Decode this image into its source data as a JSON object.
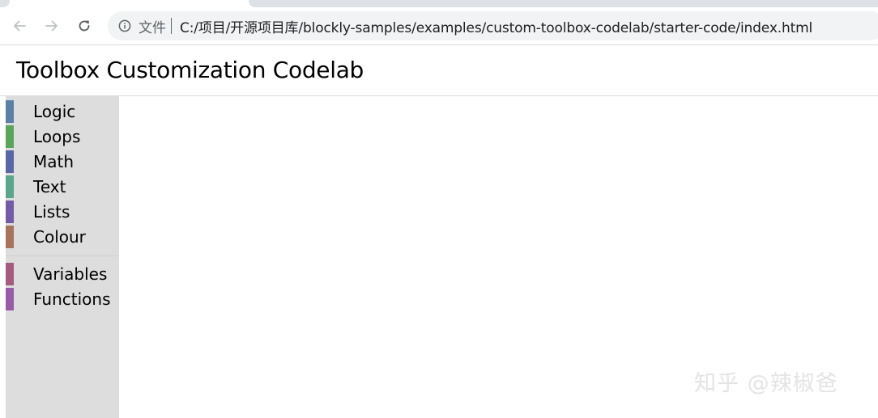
{
  "browser": {
    "omnibox": {
      "scheme_label": "文件",
      "url": "C:/项目/开源项目库/blockly-samples/examples/custom-toolbox-codelab/starter-code/index.html"
    },
    "icons": {
      "back": "back-arrow-icon",
      "forward": "forward-arrow-icon",
      "reload": "reload-icon",
      "info": "info-icon"
    }
  },
  "page": {
    "title": "Toolbox Customization Codelab"
  },
  "toolbox": {
    "categories": [
      {
        "label": "Logic",
        "color": "#5b80a5"
      },
      {
        "label": "Loops",
        "color": "#5ba55b"
      },
      {
        "label": "Math",
        "color": "#5b67a5"
      },
      {
        "label": "Text",
        "color": "#5ba58c"
      },
      {
        "label": "Lists",
        "color": "#745ba5"
      },
      {
        "label": "Colour",
        "color": "#a5745b"
      }
    ],
    "dynamic_categories": [
      {
        "label": "Variables",
        "color": "#a55b80"
      },
      {
        "label": "Functions",
        "color": "#995ba5"
      }
    ]
  },
  "watermark": {
    "text": "知乎 @辣椒爸"
  }
}
